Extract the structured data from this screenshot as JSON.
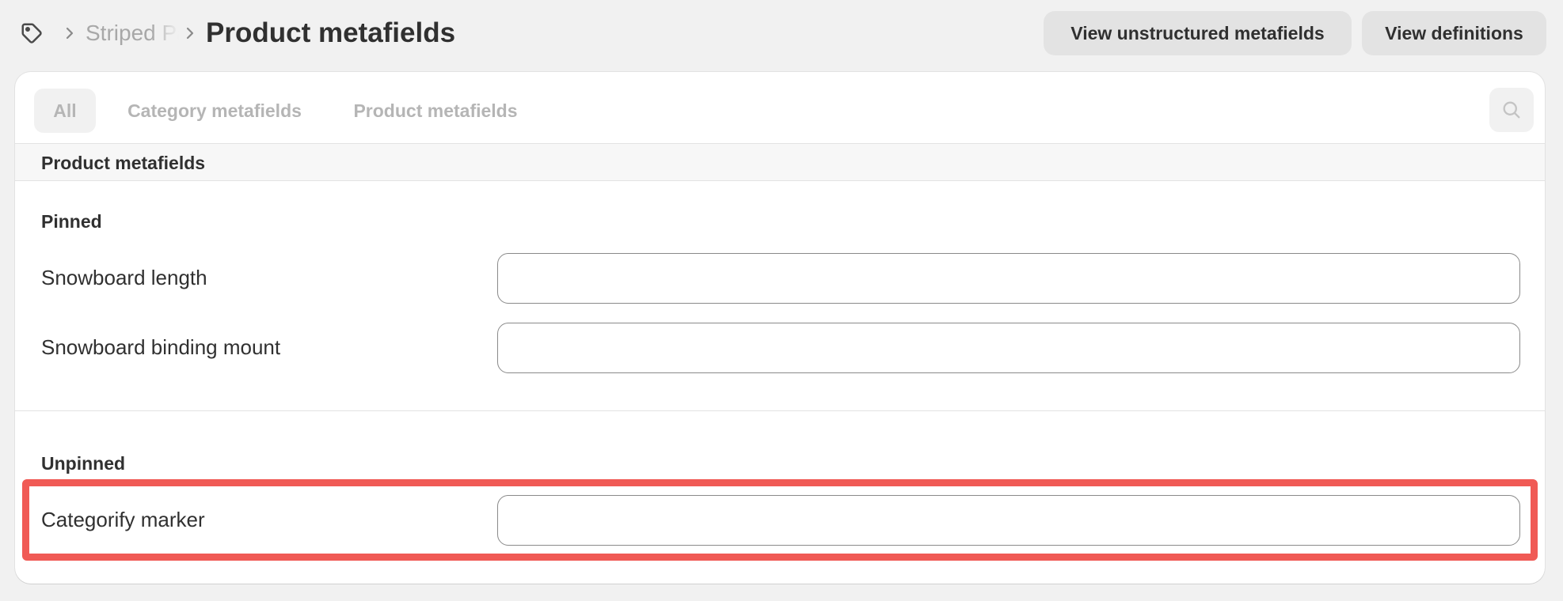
{
  "breadcrumb": {
    "icon": "tag-icon",
    "parent": "Striped Pattern Snowboard",
    "title": "Product metafields"
  },
  "actions": {
    "view_unstructured": "View unstructured metafields",
    "view_definitions": "View definitions"
  },
  "tabs": [
    {
      "label": "All",
      "selected": true
    },
    {
      "label": "Category metafields",
      "selected": false
    },
    {
      "label": "Product metafields",
      "selected": false
    }
  ],
  "search": {
    "icon": "search-icon"
  },
  "section": {
    "title": "Product metafields",
    "pinned": {
      "label": "Pinned",
      "fields": [
        {
          "label": "Snowboard length",
          "value": ""
        },
        {
          "label": "Snowboard binding mount",
          "value": ""
        }
      ]
    },
    "unpinned": {
      "label": "Unpinned",
      "fields": [
        {
          "label": "Categorify marker",
          "value": ""
        }
      ]
    }
  },
  "colors": {
    "highlight": "#f05a55",
    "background": "#f1f1f1",
    "card": "#ffffff",
    "button": "#e3e3e3"
  }
}
